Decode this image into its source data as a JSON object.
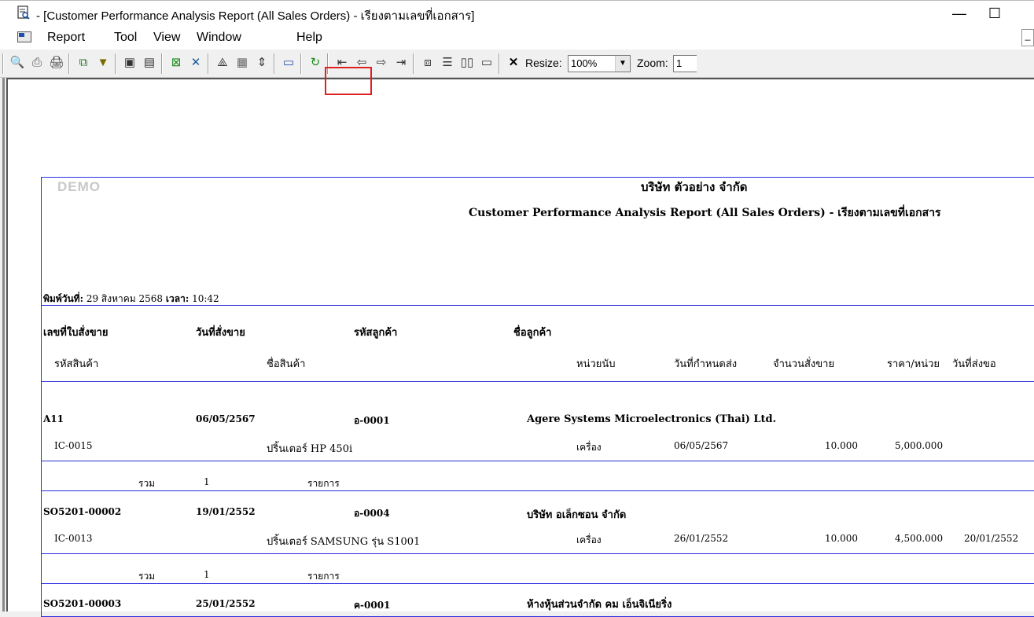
{
  "window": {
    "title": "- [Customer Performance Analysis Report (All Sales Orders) - เรียงตามเลขที่เอกสาร]",
    "minimize_glyph": "—",
    "maximize_glyph": "☐"
  },
  "menu": {
    "items": [
      "Report",
      "Tool",
      "View",
      "Window",
      "Help"
    ],
    "right_glyph": "_"
  },
  "toolbar": {
    "icons": {
      "search": "🔍",
      "export": "⎙",
      "print": "🖨",
      "copy": "⧉",
      "filter": "▼",
      "doc1": "▣",
      "doc2": "▤",
      "excel1": "⊠",
      "excel2": "✕",
      "signature": "⟁",
      "grid": "▦",
      "vsize": "⇕",
      "calc": "▭",
      "refresh": "↻",
      "first": "⇤",
      "prev": "⇦",
      "next": "⇨",
      "last": "⇥",
      "layout1": "⧈",
      "layout2": "☰",
      "layout3": "▯▯",
      "layout4": "▭",
      "close": "✕"
    },
    "resize_label": "Resize:",
    "resize_value": "100%",
    "zoom_label": "Zoom:",
    "zoom_value": "1",
    "dropdown_glyph": "▼"
  },
  "report": {
    "watermark": "DEMO",
    "company": "บริษัท ตัวอย่าง จำกัด",
    "title": "Customer Performance Analysis Report (All Sales Orders) - เรียงตามเลขที่เอกสาร",
    "printed_label": "พิมพ์วันที่:",
    "printed_date": "29 สิงหาคม 2568",
    "time_label": "เวลา:",
    "time_value": "10:42",
    "header": {
      "so_no": "เลขที่ใบสั่งขาย",
      "so_date": "วันที่สั่งขาย",
      "cust_code": "รหัสลูกค้า",
      "cust_name": "ชื่อลูกค้า",
      "item_code": "รหัสสินค้า",
      "item_name": "ชื่อสินค้า",
      "unit": "หน่วยนับ",
      "due_date": "วันที่กำหนดส่ง",
      "qty": "จำนวนสั่งขาย",
      "price": "ราคา/หน่วย",
      "ship_date": "วันที่ส่งขอ"
    },
    "orders": [
      {
        "so_no": "A11",
        "so_date": "06/05/2567",
        "cust_code": "อ-0001",
        "cust_name": "Agere Systems Microelectronics (Thai) Ltd.",
        "item_code": "IC-0015",
        "item_name": "ปริ้นเตอร์ HP 450i",
        "unit": "เครื่อง",
        "due_date": "06/05/2567",
        "qty": "10.000",
        "price": "5,000.000",
        "ship_date": "",
        "total_label": "รวม",
        "total_count": "1",
        "total_unit": "รายการ"
      },
      {
        "so_no": "SO5201-00002",
        "so_date": "19/01/2552",
        "cust_code": "อ-0004",
        "cust_name": "บริษัท อเล็กซอน จำกัด",
        "item_code": "IC-0013",
        "item_name": "ปริ้นเตอร์ SAMSUNG รุ่น S1001",
        "unit": "เครื่อง",
        "due_date": "26/01/2552",
        "qty": "10.000",
        "price": "4,500.000",
        "ship_date": "20/01/2552",
        "total_label": "รวม",
        "total_count": "1",
        "total_unit": "รายการ"
      },
      {
        "so_no": "SO5201-00003",
        "so_date": "25/01/2552",
        "cust_code": "ค-0001",
        "cust_name": "ห้างหุ้นส่วนจำกัด คม เอ็นจิเนียริ่ง"
      }
    ]
  }
}
